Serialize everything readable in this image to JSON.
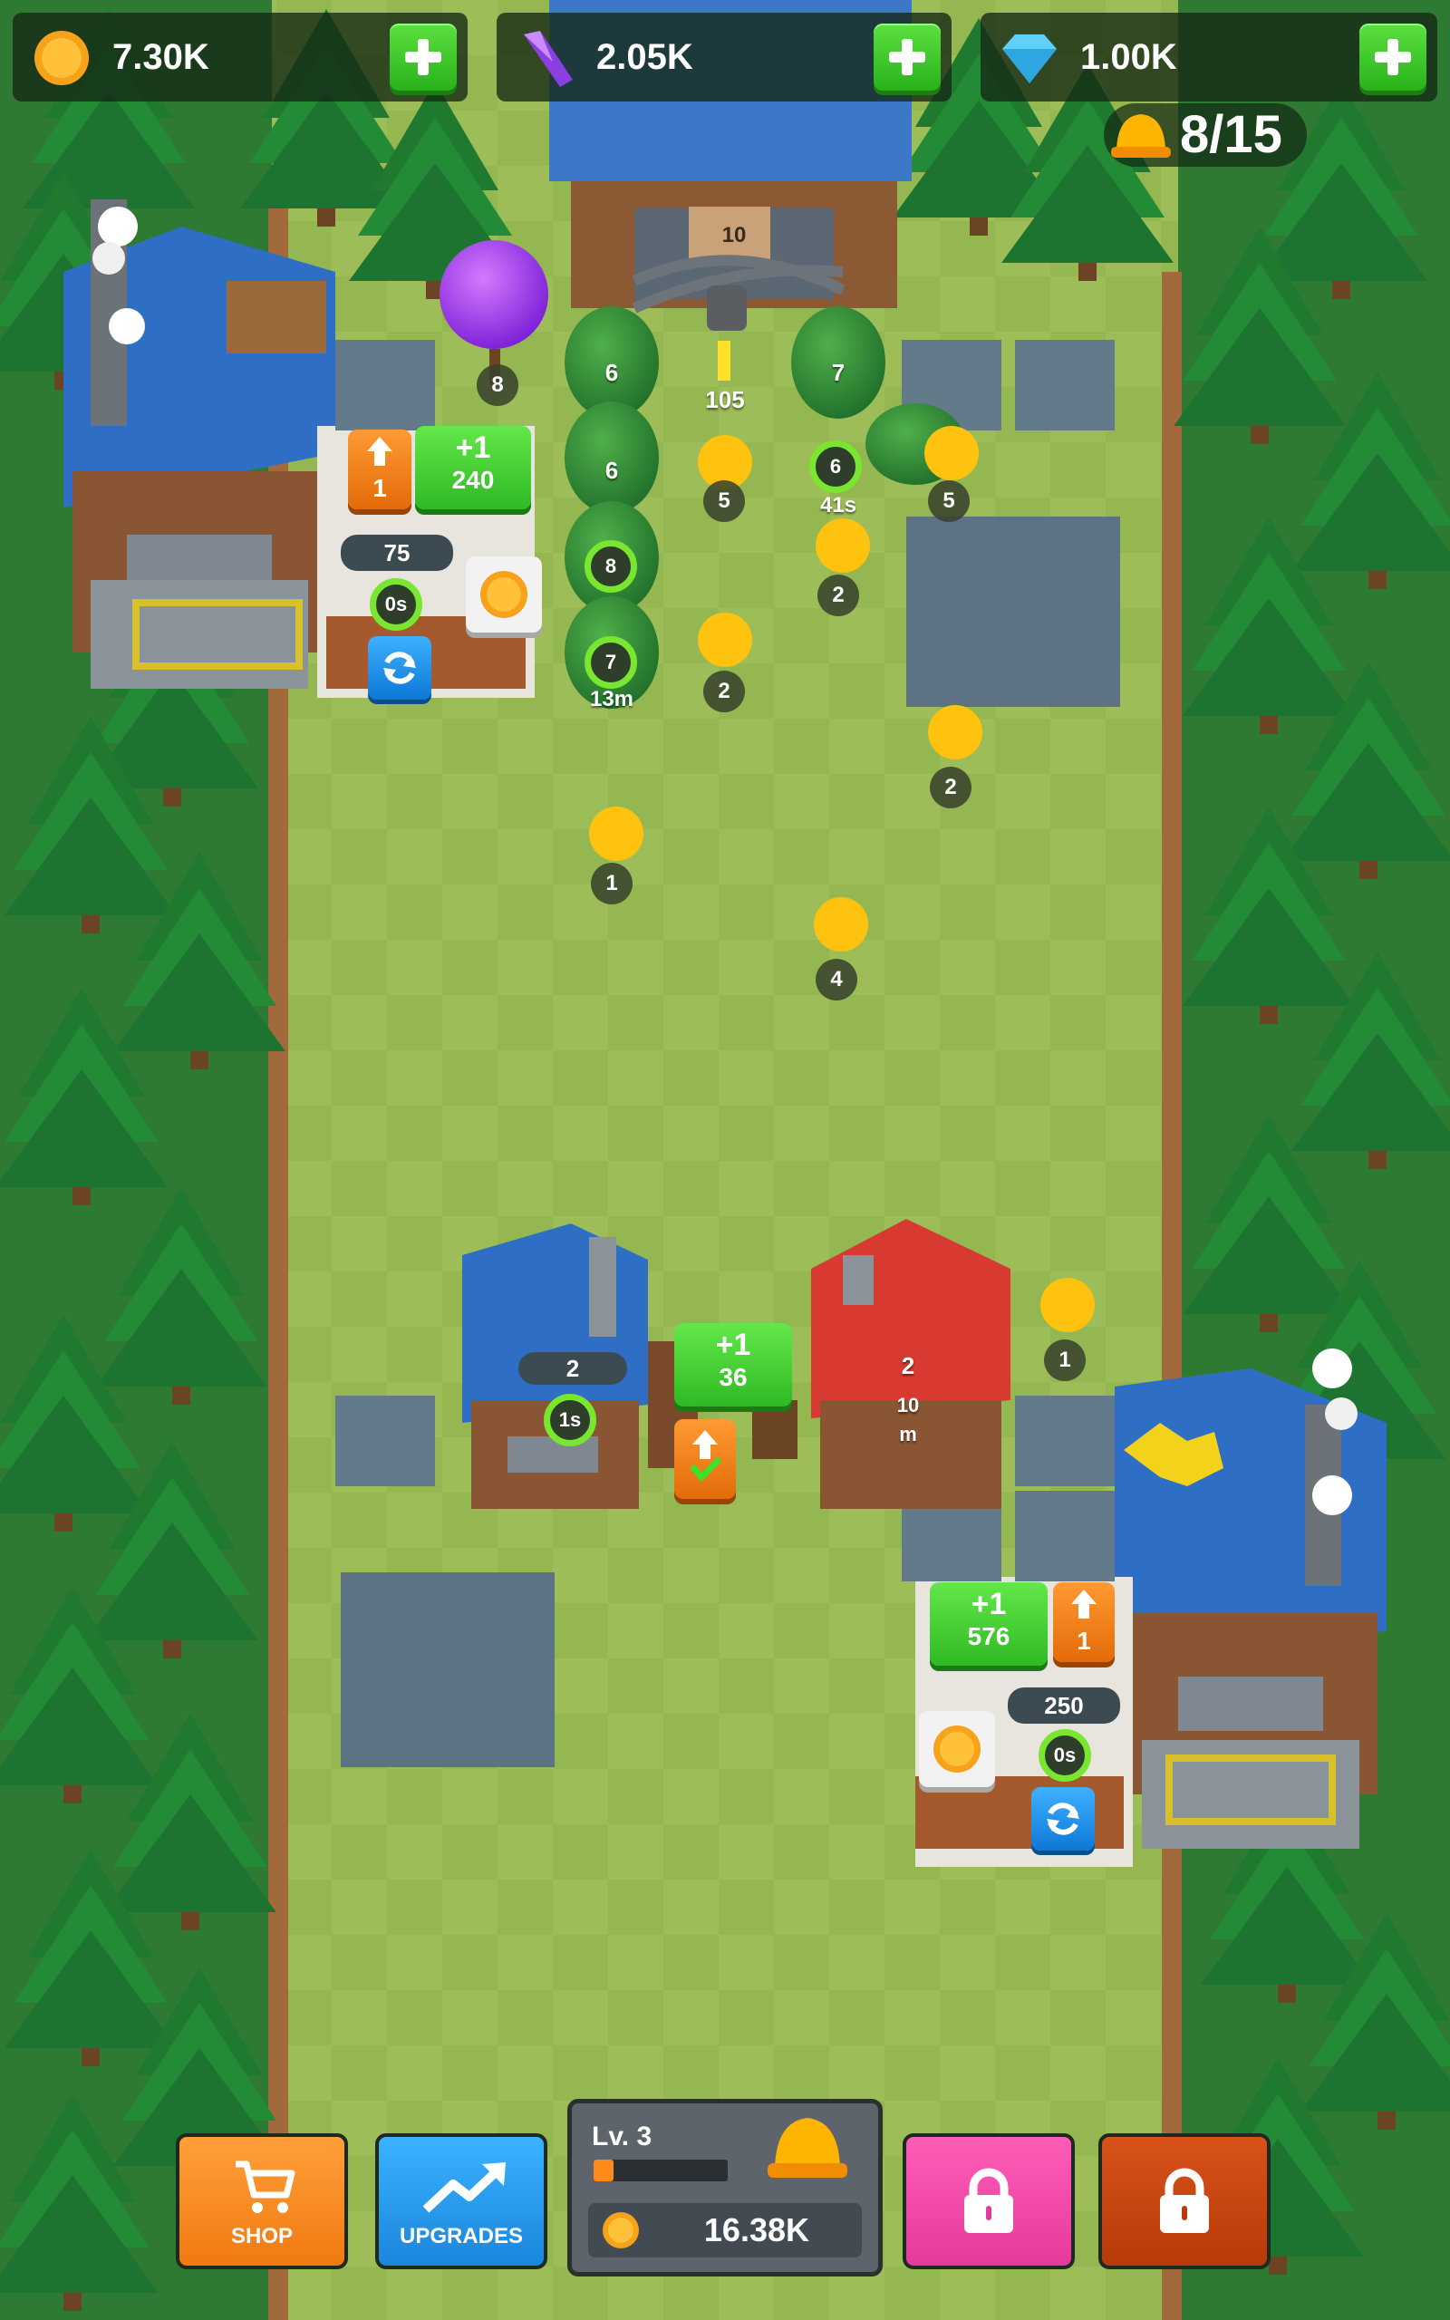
{
  "resources": {
    "coins": "7.30K",
    "crystals": "2.05K",
    "diamonds": "1.00K"
  },
  "workers": {
    "count": "8/15"
  },
  "locked_gate": {
    "level": "10",
    "cost": "105"
  },
  "trees": {
    "t1": "6",
    "t2": "7",
    "t3": "6",
    "t4": "6",
    "t5": "8",
    "t6": "7",
    "timer_41s": "41s",
    "timer_13m": "13m"
  },
  "purple_tree": {
    "level": "8"
  },
  "workers_lvls": {
    "w1": "5",
    "w2": "5",
    "w3": "2",
    "w4": "2",
    "w5": "2",
    "w6": "1",
    "w7": "4",
    "w8": "1"
  },
  "station_left": {
    "upgrade_level": "1",
    "gain": "+1",
    "gain_amount": "240",
    "capacity": "75",
    "timer": "0s"
  },
  "station_right": {
    "upgrade_level": "1",
    "gain": "+1",
    "gain_amount": "576",
    "capacity": "250",
    "timer": "0s"
  },
  "house_blue": {
    "level": "2",
    "timer": "1s"
  },
  "house_red": {
    "level": "2",
    "timer": "10",
    "timer_unit": "m"
  },
  "center_card": {
    "gain": "+1",
    "amount": "36"
  },
  "bottom": {
    "shop_label": "SHOP",
    "upgrades_label": "UPGRADES",
    "level": "Lv. 3",
    "level_progress": 0.15,
    "money": "16.38K"
  },
  "colors": {
    "grass": "#8fb24f",
    "path": "#a4c258",
    "bark": "#a26a3c",
    "shop": "#ff8a1c",
    "upgrades": "#2a9de8",
    "locked_pink": "#f04ca8",
    "locked_brown": "#c8420e"
  }
}
